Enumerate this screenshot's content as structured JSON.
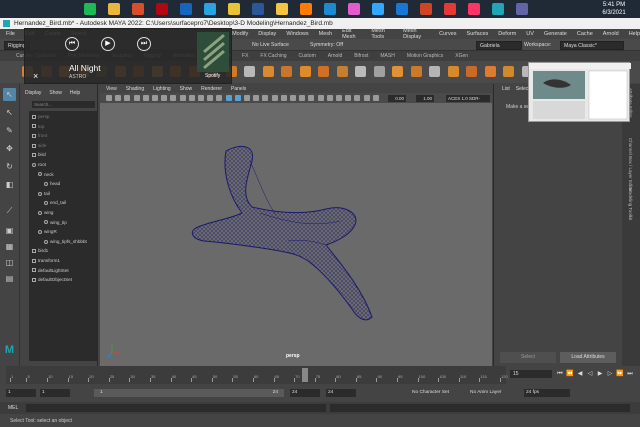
{
  "taskbar": {
    "time": "5:41 PM",
    "date": "6/3/2021",
    "icons": [
      {
        "name": "spotify-icon",
        "color": "#1db954"
      },
      {
        "name": "chrome-icon",
        "color": "#e8b73b"
      },
      {
        "name": "fire-icon",
        "color": "#d94e2a"
      },
      {
        "name": "netflix-icon",
        "color": "#b20710"
      },
      {
        "name": "outlook-icon",
        "color": "#1565c0"
      },
      {
        "name": "edge-icon",
        "color": "#2aa4e0"
      },
      {
        "name": "chrome-icon",
        "color": "#e9c236"
      },
      {
        "name": "word-icon",
        "color": "#2b579a"
      },
      {
        "name": "explorer-icon",
        "color": "#f5c542"
      },
      {
        "name": "illustrator-icon",
        "color": "#ff7c00"
      },
      {
        "name": "edge-icon",
        "color": "#1b8bd0"
      },
      {
        "name": "itunes-icon",
        "color": "#e45bd0"
      },
      {
        "name": "photoshop-icon",
        "color": "#31a8ff"
      },
      {
        "name": "outlook-icon",
        "color": "#1976d2"
      },
      {
        "name": "powerpoint-icon",
        "color": "#d04423"
      },
      {
        "name": "acrobat-icon",
        "color": "#e53935"
      },
      {
        "name": "indesign-icon",
        "color": "#ff3366"
      },
      {
        "name": "maya-icon",
        "color": "#1fa5b3"
      },
      {
        "name": "teams-icon",
        "color": "#6264a7"
      }
    ]
  },
  "window": {
    "title": "Hernandez_Bird.mb* - Autodesk MAYA 2022: C:\\Users\\surfacepro7\\Desktop\\3-D Modeling\\Hernandez_Bird.mb"
  },
  "menubar": [
    "File",
    "Edit",
    "Create",
    "Select",
    "Modify",
    "Display",
    "Windows",
    "Mesh",
    "Edit Mesh",
    "Mesh Tools",
    "Mesh Display",
    "Curves",
    "Surfaces",
    "Deform",
    "UV",
    "Generate",
    "Cache",
    "Arnold",
    "Help"
  ],
  "statusline": {
    "menuset": "Rigging",
    "live_surface": "No Live Surface",
    "symmetry": "Symmetry: Off",
    "account": "Gabriela hernandez",
    "workspace_label": "Workspace:",
    "workspace": "Maya Classic*"
  },
  "shelf_tabs": [
    "Curves / Surfaces",
    "Poly Modeling",
    "Sculpting",
    "Rigging",
    "Animation",
    "Rendering",
    "FX",
    "FX Caching",
    "Custom",
    "Arnold",
    "Bifrost",
    "MASH",
    "Motion Graphics",
    "XGen"
  ],
  "spotify": {
    "song": "All Night",
    "artist": "ASTRO",
    "app_label": "Spotify",
    "close": "×",
    "prev": "⏮",
    "play": "▶",
    "next": "⏭",
    "colors": {
      "album": "#2e4d3a",
      "stripe": "#8ca27f"
    }
  },
  "outliner": {
    "menu": [
      "Display",
      "Show",
      "Help"
    ],
    "search_placeholder": "Search...",
    "rows": [
      {
        "label": "persp",
        "indent": 0,
        "faint": true,
        "kind": "camera"
      },
      {
        "label": "top",
        "indent": 0,
        "faint": true,
        "kind": "camera"
      },
      {
        "label": "front",
        "indent": 0,
        "faint": true,
        "kind": "camera"
      },
      {
        "label": "side",
        "indent": 0,
        "faint": true,
        "kind": "camera"
      },
      {
        "label": "bird",
        "indent": 0,
        "faint": false,
        "kind": "mesh"
      },
      {
        "label": "root",
        "indent": 0,
        "faint": false,
        "kind": "joint"
      },
      {
        "label": "neck",
        "indent": 1,
        "faint": false,
        "kind": "joint"
      },
      {
        "label": "head",
        "indent": 2,
        "faint": false,
        "kind": "joint"
      },
      {
        "label": "tail",
        "indent": 1,
        "faint": false,
        "kind": "joint"
      },
      {
        "label": "end_tail",
        "indent": 2,
        "faint": false,
        "kind": "joint"
      },
      {
        "label": "wing",
        "indent": 1,
        "faint": false,
        "kind": "joint"
      },
      {
        "label": "wing_tip",
        "indent": 2,
        "faint": false,
        "kind": "joint"
      },
      {
        "label": "wingR",
        "indent": 1,
        "faint": false,
        "kind": "joint"
      },
      {
        "label": "wing_tipfs_shbbbt",
        "indent": 2,
        "faint": false,
        "kind": "joint"
      },
      {
        "label": "bird1",
        "indent": 0,
        "faint": false,
        "kind": "mesh"
      },
      {
        "label": "transform1",
        "indent": 0,
        "faint": false,
        "kind": "mesh"
      },
      {
        "label": "defaultLightSet",
        "indent": 0,
        "faint": false,
        "kind": "set"
      },
      {
        "label": "defaultObjectSet",
        "indent": 0,
        "faint": false,
        "kind": "set"
      }
    ]
  },
  "viewport": {
    "menu": [
      "View",
      "Shading",
      "Lighting",
      "Show",
      "Renderer",
      "Panels"
    ],
    "near_clip": "0.00",
    "far_clip": "1.00",
    "colorspace": "ACES 1.0 SDR-video",
    "camera_label": "persp",
    "background": "#6a6a6a",
    "wire_color": "#1a1a6e"
  },
  "rightpanel": {
    "tabs": [
      "List",
      "Selected",
      "Focus",
      "Attributes",
      "Show",
      "Help"
    ],
    "message": "Make a selection",
    "select_btn": "Select",
    "load_btn": "Load Attributes",
    "side_tabs": [
      "Attribute Editor",
      "Channel Box / Layer Editor",
      "Modeling Toolkit"
    ]
  },
  "timeline": {
    "ticks": [
      1,
      5,
      10,
      15,
      20,
      25,
      30,
      35,
      40,
      45,
      50,
      55,
      60,
      65,
      70,
      75,
      80,
      85,
      90,
      95,
      100,
      105,
      110,
      115,
      120
    ],
    "current_frame": "15",
    "playback": [
      "⏮",
      "⏪",
      "◀",
      "◁",
      "▶",
      "▷",
      "⏩",
      "⏭"
    ]
  },
  "range": {
    "start": "1",
    "inner_start": "1",
    "range_start": "1",
    "range_end": "24",
    "inner_end": "24",
    "end": "24",
    "character_set": "No Character Set",
    "anim_layer": "No Anim Layer",
    "fps": "24 fps"
  },
  "command": {
    "label": "MEL",
    "help": "Select Tool: select an object"
  }
}
